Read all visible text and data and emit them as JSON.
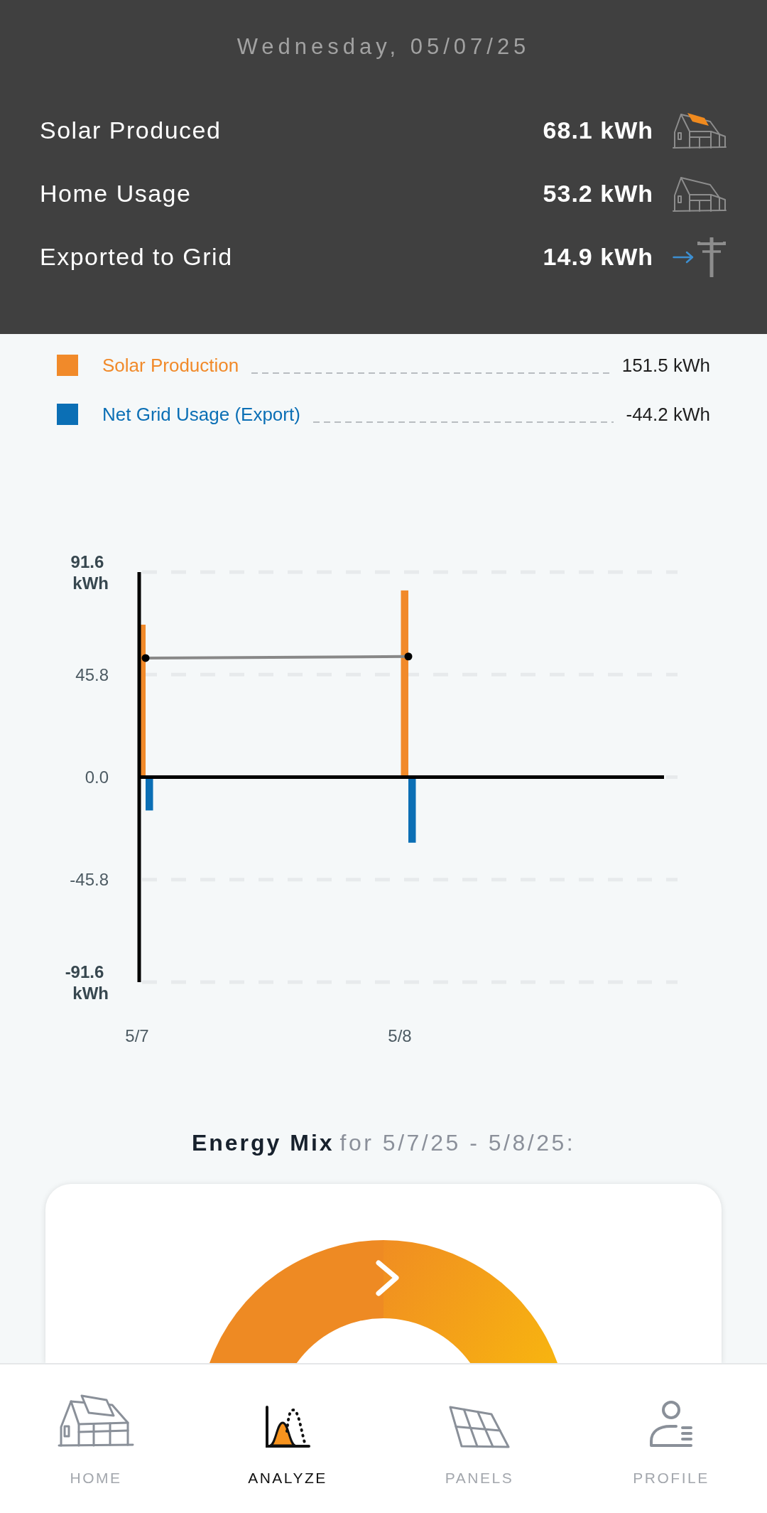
{
  "header": {
    "date": "Wednesday, 05/07/25",
    "stats": [
      {
        "kind": "solar",
        "label": "Solar Produced",
        "value": "68.1 kWh"
      },
      {
        "kind": "home",
        "label": "Home Usage",
        "value": "53.2 kWh"
      },
      {
        "kind": "export",
        "label": "Exported to Grid",
        "value": "14.9 kWh"
      }
    ]
  },
  "chart": {
    "legend": [
      {
        "value": "151.5 kWh"
      },
      {
        "value": "-44.2 kWh"
      }
    ],
    "chart_data": {
      "type": "bar",
      "grid": true,
      "categories": [
        "5/7",
        "5/8"
      ],
      "series": [
        {
          "type": "bar",
          "name": "Solar Production",
          "color": "#f18a2a",
          "values": [
            68.1,
            83.4
          ]
        },
        {
          "type": "bar",
          "name": "Net Grid Usage (Export)",
          "color": "#0b6fb5",
          "values": [
            -14.9,
            -29.3
          ]
        },
        {
          "type": "line",
          "marker": "circle",
          "color": "#888888",
          "values": [
            53.2,
            53.9
          ]
        }
      ],
      "ylim": [
        -91.6,
        91.6
      ],
      "yticks": [
        {
          "value": 91.6,
          "label": "91.6 kWh"
        },
        {
          "value": 45.8,
          "label": "45.8"
        },
        {
          "value": 0,
          "label": "0.0"
        },
        {
          "value": -45.8,
          "label": "-45.8"
        },
        {
          "value": -91.6,
          "label": "-91.6 kWh"
        }
      ]
    }
  },
  "energy_mix": {
    "title": "Energy Mix",
    "period": "for 5/7/25 - 5/8/25:"
  },
  "tab_bar": {
    "tabs": [
      {
        "label": "HOME",
        "selected": false
      },
      {
        "label": "ANALYZE",
        "selected": true
      },
      {
        "label": "PANELS",
        "selected": false
      },
      {
        "label": "PROFILE",
        "selected": false
      }
    ]
  }
}
